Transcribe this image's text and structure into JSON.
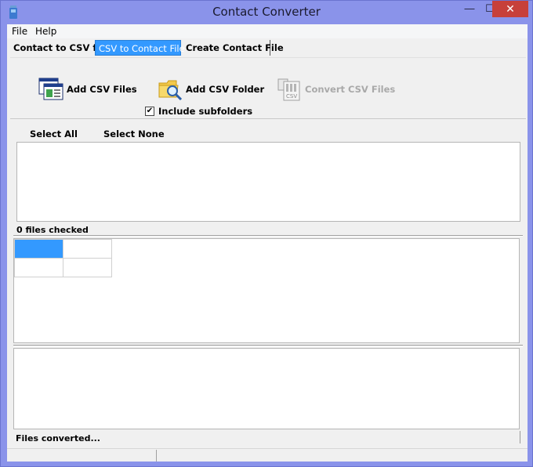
{
  "window": {
    "title": "Contact Converter",
    "minimize_glyph": "—",
    "maximize_glyph": "☐",
    "close_glyph": "✕"
  },
  "menu": {
    "file_label": "File",
    "help_label": "Help"
  },
  "tabs": [
    {
      "label": "Contact to CSV file",
      "active": false
    },
    {
      "label": "CSV to Contact File",
      "active": true
    },
    {
      "label": "Create Contact File",
      "active": false
    }
  ],
  "toolbar": {
    "add_files_label": "Add CSV Files",
    "add_folder_label": "Add CSV Folder",
    "convert_label": "Convert CSV Files",
    "convert_enabled": false,
    "include_subfolders_label": "Include subfolders",
    "include_subfolders_checked": true,
    "check_glyph": "✔"
  },
  "selection": {
    "select_all_label": "Select All",
    "select_none_label": "Select None"
  },
  "status": {
    "files_checked_text": "0 files checked",
    "files_converted_text": "Files converted..."
  },
  "icons": {
    "app": "app-icon",
    "add_files": "window-list-icon",
    "add_folder": "folder-search-icon",
    "convert": "csv-document-icon"
  },
  "colors": {
    "frame": "#8a93ea",
    "active_tab": "#3399ff",
    "selected_cell": "#3399ff",
    "close_button": "#c7403a"
  }
}
